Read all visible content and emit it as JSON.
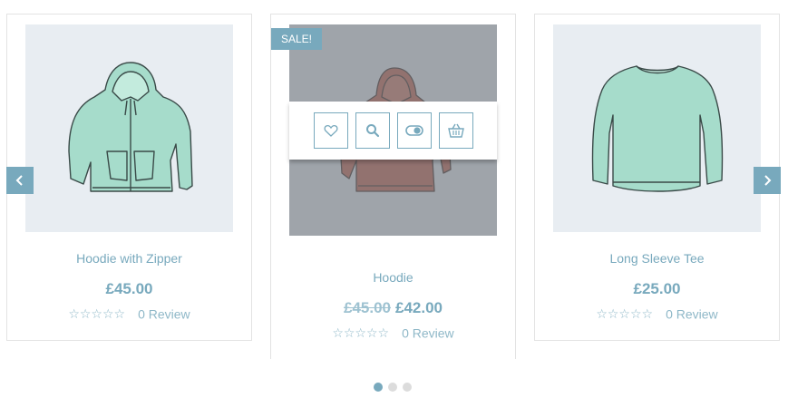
{
  "colors": {
    "accent": "#78a9bd",
    "image_bg": "#e8edf2",
    "garment": "#a6dccb"
  },
  "products": [
    {
      "name": "Hoodie with Zipper",
      "price": "£45.00",
      "rating": 0,
      "stars": "☆☆☆☆☆",
      "review": "0 Review",
      "image_icon": "zip-hoodie-image"
    },
    {
      "name": "Hoodie",
      "sale_badge": "SALE!",
      "old_price": "£45.00",
      "price": "£42.00",
      "rating": 0,
      "stars": "☆☆☆☆☆",
      "review": "0 Review",
      "image_icon": "hoodie-image"
    },
    {
      "name": "Long Sleeve Tee",
      "price": "£25.00",
      "rating": 0,
      "stars": "☆☆☆☆☆",
      "review": "0 Review",
      "image_icon": "long-sleeve-tee-image"
    }
  ],
  "actions": [
    {
      "icon": "heart-icon"
    },
    {
      "icon": "search-icon"
    },
    {
      "icon": "compare-icon"
    },
    {
      "icon": "basket-icon"
    }
  ],
  "carousel": {
    "prev_icon": "chevron-left-icon",
    "next_icon": "chevron-right-icon",
    "pages": 3,
    "active_page": 1
  }
}
